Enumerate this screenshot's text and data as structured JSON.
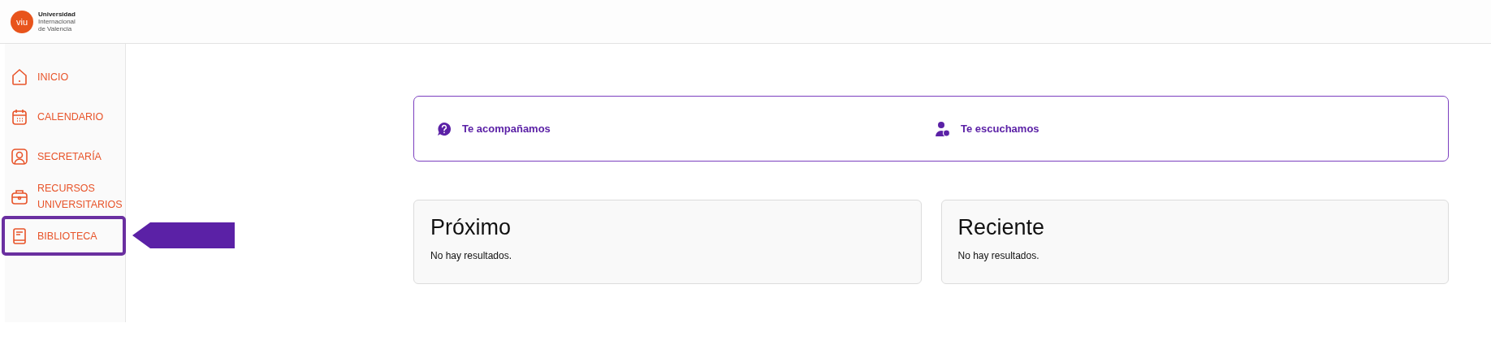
{
  "header": {
    "logo": {
      "mark": "viu",
      "lines": [
        "Universidad",
        "Internacional",
        "de Valencia"
      ]
    }
  },
  "sidebar": {
    "items": [
      {
        "label": "INICIO",
        "kind": "home",
        "highlighted": false
      },
      {
        "label": "CALENDARIO",
        "kind": "calendar",
        "highlighted": false
      },
      {
        "label": "SECRETARÍA",
        "kind": "person",
        "highlighted": false
      },
      {
        "label": "RECURSOS UNIVERSITARIOS",
        "kind": "briefcase",
        "highlighted": false
      },
      {
        "label": "BIBLIOTECA",
        "kind": "book",
        "highlighted": true
      }
    ]
  },
  "help": {
    "items": [
      {
        "label": "Te acompañamos",
        "kind": "question"
      },
      {
        "label": "Te escuchamos",
        "kind": "listener"
      }
    ]
  },
  "cards": [
    {
      "title": "Próximo",
      "text": "No hay resultados."
    },
    {
      "title": "Reciente",
      "text": "No hay resultados."
    }
  ]
}
